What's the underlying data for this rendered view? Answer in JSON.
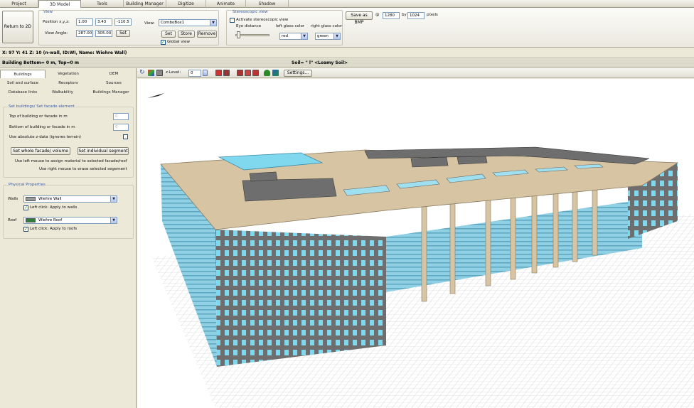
{
  "tabs": [
    {
      "label": "Project"
    },
    {
      "label": "3D Model"
    },
    {
      "label": "Tools"
    },
    {
      "label": "Building Manager"
    },
    {
      "label": "Digitize"
    },
    {
      "label": "Animate"
    },
    {
      "label": "Shadow"
    }
  ],
  "ribbon": {
    "return_label": "Return to 2D",
    "view_group": {
      "title": "View",
      "position_label": "Position x,y,z:",
      "pos_x": "1.00",
      "pos_y": "3.43",
      "pos_z": "-110.5",
      "angle_label": "View Angle:",
      "angle_a": "287.00",
      "angle_b": "305.00",
      "set_label": "Set",
      "view_label": "View:",
      "view_combo": "ComboBox1",
      "set2_label": "Set",
      "store_label": "Store",
      "remove_label": "Remove",
      "global_view_label": "Global view",
      "global_view_checked": true
    },
    "stereo_group": {
      "title": "Stereoscopic view",
      "activate_label": "Activate stereoscopic view",
      "activate_checked": false,
      "eye_distance_label": "Eye distance",
      "left_glass_label": "left glass color",
      "left_glass_value": "red",
      "right_glass_label": "right glass color",
      "right_glass_value": "green"
    },
    "save_bmp_label": "Save as BMP",
    "at_symbol": "@",
    "width_value": "1280",
    "by_label": "by",
    "height_value": "1024",
    "pixels_label": "pixels"
  },
  "coord_status": "X: 97  Y: 41  Z: 10  (n-wall, ID:WI, Name: Wiehre Wall)",
  "info_bar": {
    "building_text": "Building Bottom= 0 m, Top=0 m",
    "soil_text": "Soil= \" l\"  <Loamy Soil>"
  },
  "left_panel": {
    "tabs_row1": [
      "Buildings",
      "Vegetation",
      "DEM"
    ],
    "tabs_row2": [
      "Soil and surface",
      "Receptors",
      "Sources"
    ],
    "tabs_row3": [
      "Database links",
      "Walkability",
      "Buildings Manager"
    ],
    "facade_section": {
      "title": "Set buildings/ Set facade element",
      "top_label": "Top of building or facade in m",
      "top_value": "0",
      "bottom_label": "Bottom of building or facade in m",
      "bottom_value": "0",
      "absolute_label": "Use absolute z-data (ignores terrain)",
      "absolute_checked": false,
      "whole_button": "Set whole facade/ volume",
      "individual_button": "Set individual segment",
      "hint_left": "Use left mouse to assign material to selected facade/roof",
      "hint_right": "Use right mouse to erase selected segement"
    },
    "physical_section": {
      "title": "Physical Properties",
      "walls_label": "Walls",
      "walls_value": "Wiehre Wall",
      "walls_color": "#9a9a9a",
      "walls_apply_label": "Left click: Apply to walls",
      "walls_apply_checked": true,
      "roof_label": "Roof",
      "roof_value": "Wiehre Roof",
      "roof_color": "#2e7d3a",
      "roof_apply_label": "Left click: Apply to roofs",
      "roof_apply_checked": true
    }
  },
  "toolbar": {
    "zlevel_label": "z-Level:",
    "zlevel_value": "0",
    "settings_label": "Settings..."
  },
  "colors": {
    "roof_beige": "#d6c4a3",
    "wall_gray": "#6e6e6e",
    "glass_cyan": "#7fd8ee",
    "grid_line": "#c4c4c4"
  },
  "icons": [
    "refresh-icon",
    "palette-icon",
    "grid-icon",
    "spin-icon",
    "color-swatch-icon",
    "tree-icon",
    "layer-icon",
    "north-arrow-icon"
  ]
}
